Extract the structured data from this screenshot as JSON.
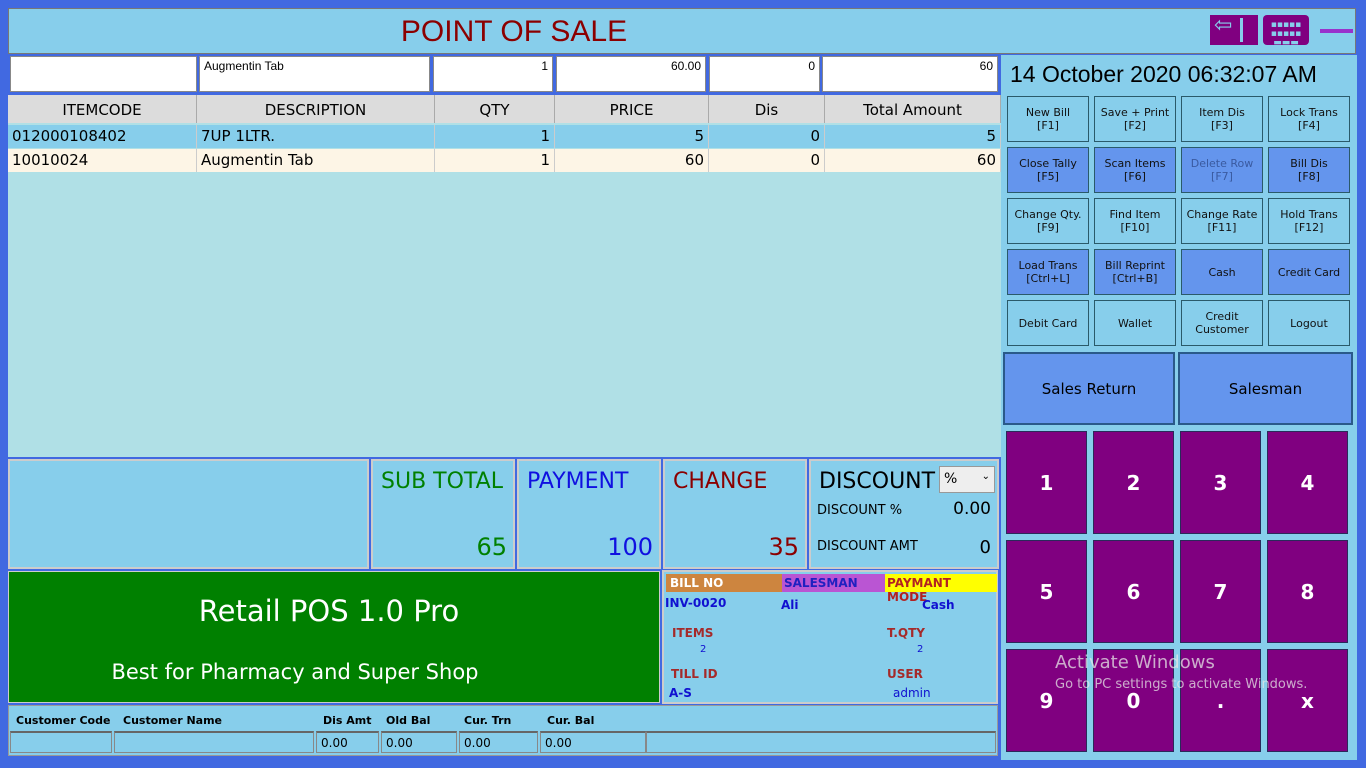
{
  "header": {
    "title": "POINT OF SALE",
    "icons": [
      "exit-icon",
      "keyboard-icon",
      "minimize-icon"
    ]
  },
  "entry": {
    "code": "",
    "description": "Augmentin Tab",
    "qty": "1",
    "price": "60.00",
    "dis": "0",
    "total": "60"
  },
  "datetime": "14 October 2020 06:32:07 AM",
  "grid": {
    "columns": [
      "ITEMCODE",
      "DESCRIPTION",
      "QTY",
      "PRICE",
      "Dis",
      "Total Amount"
    ],
    "rows": [
      [
        "012000108402",
        "7UP 1LTR.",
        "1",
        "5",
        "0",
        "5"
      ],
      [
        "10010024",
        "Augmentin Tab",
        "1",
        "60",
        "0",
        "60"
      ]
    ]
  },
  "totals": {
    "subtotal_label": "SUB TOTAL",
    "subtotal": "65",
    "payment_label": "PAYMENT",
    "payment": "100",
    "change_label": "CHANGE",
    "change": "35",
    "discount_label": "DISCOUNT",
    "discount_type": "%",
    "discount_pct_label": "DISCOUNT %",
    "discount_pct": "0.00",
    "discount_amt_label": "DISCOUNT AMT",
    "discount_amt": "0"
  },
  "brand": {
    "name": "Retail POS 1.0 Pro",
    "tagline": "Best for Pharmacy and Super Shop"
  },
  "info": {
    "bill_no_label": "BILL NO",
    "bill_no": "INV-0020",
    "salesman_label": "SALESMAN",
    "salesman": "Ali",
    "payment_mode_label": "PAYMANT MODE",
    "payment_mode": "Cash",
    "items_label": "ITEMS",
    "items": "2",
    "tqty_label": "T.QTY",
    "tqty": "2",
    "till_label": "TILL ID",
    "till": "A-S",
    "user_label": "USER",
    "user": "admin"
  },
  "customer": {
    "labels": [
      "Customer Code",
      "Customer Name",
      "Dis Amt",
      "Old Bal",
      "Cur. Trn",
      "Cur. Bal"
    ],
    "values": [
      "",
      "",
      "0.00",
      "0.00",
      "0.00",
      "0.00"
    ]
  },
  "buttons": [
    "New Bill\n[F1]",
    "Save + Print\n[F2]",
    "Item Dis\n[F3]",
    "Lock Trans\n[F4]",
    "Close Tally\n[F5]",
    "Scan Items\n[F6]",
    "Delete Row\n[F7]",
    "Bill Dis\n[F8]",
    "Change Qty.\n[F9]",
    "Find Item\n[F10]",
    "Change Rate\n[F11]",
    "Hold Trans\n[F12]",
    "Load Trans\n[Ctrl+L]",
    "Bill Reprint\n[Ctrl+B]",
    "Cash",
    "Credit Card",
    "Debit Card",
    "Wallet",
    "Credit\nCustomer",
    "Logout"
  ],
  "big_buttons": {
    "sales_return": "Sales Return",
    "salesman": "Salesman"
  },
  "numpad": [
    "1",
    "2",
    "3",
    "4",
    "5",
    "6",
    "7",
    "8",
    "9",
    "0",
    ".",
    "x"
  ],
  "watermark": {
    "line1": "Activate Windows",
    "line2": "Go to PC settings to activate Windows."
  },
  "colors": {
    "panel": "#87ceeb",
    "accent": "#800080",
    "title": "#8b0000",
    "green": "#008000"
  }
}
